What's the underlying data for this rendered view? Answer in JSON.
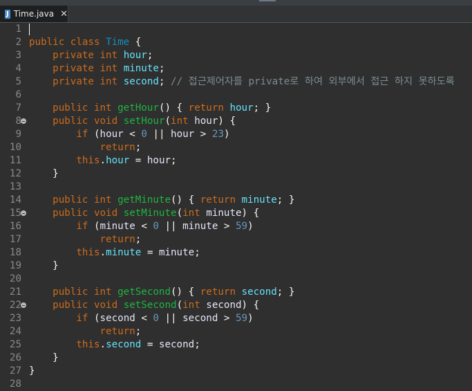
{
  "editor_tab": {
    "file_icon": "java-file-icon",
    "icon_letter": "J",
    "title": "Time.java",
    "close_glyph": "✕"
  },
  "colors": {
    "keyword": "#cc6c1d",
    "type_name": "#1290c3",
    "field": "#66e1f8",
    "method": "#1eb540",
    "number": "#6897bb",
    "comment": "#7d8c93",
    "background": "#2f2f2f"
  },
  "lines": [
    {
      "no": "1",
      "fold": false,
      "tokens": []
    },
    {
      "no": "2",
      "fold": false,
      "tokens": [
        [
          "kw",
          "public"
        ],
        [
          "pn",
          " "
        ],
        [
          "kw",
          "class"
        ],
        [
          "pn",
          " "
        ],
        [
          "ty",
          "Time"
        ],
        [
          "pn",
          " {"
        ]
      ]
    },
    {
      "no": "3",
      "fold": false,
      "tokens": [
        [
          "pn",
          "    "
        ],
        [
          "kw",
          "private"
        ],
        [
          "pn",
          " "
        ],
        [
          "kw",
          "int"
        ],
        [
          "pn",
          " "
        ],
        [
          "fd",
          "hour"
        ],
        [
          "pn",
          ";"
        ]
      ]
    },
    {
      "no": "4",
      "fold": false,
      "tokens": [
        [
          "pn",
          "    "
        ],
        [
          "kw",
          "private"
        ],
        [
          "pn",
          " "
        ],
        [
          "kw",
          "int"
        ],
        [
          "pn",
          " "
        ],
        [
          "fd",
          "minute"
        ],
        [
          "pn",
          ";"
        ]
      ]
    },
    {
      "no": "5",
      "fold": false,
      "tokens": [
        [
          "pn",
          "    "
        ],
        [
          "kw",
          "private"
        ],
        [
          "pn",
          " "
        ],
        [
          "kw",
          "int"
        ],
        [
          "pn",
          " "
        ],
        [
          "fd",
          "second"
        ],
        [
          "pn",
          "; "
        ],
        [
          "cm",
          "// 접근제어자를 private로 하여 외부에서 접근 하지 못하도록"
        ]
      ]
    },
    {
      "no": "6",
      "fold": false,
      "tokens": []
    },
    {
      "no": "7",
      "fold": false,
      "tokens": [
        [
          "pn",
          "    "
        ],
        [
          "kw",
          "public"
        ],
        [
          "pn",
          " "
        ],
        [
          "kw",
          "int"
        ],
        [
          "pn",
          " "
        ],
        [
          "fn",
          "getHour"
        ],
        [
          "pn",
          "() { "
        ],
        [
          "kw",
          "return"
        ],
        [
          "pn",
          " "
        ],
        [
          "fd",
          "hour"
        ],
        [
          "pn",
          "; }"
        ]
      ]
    },
    {
      "no": "8",
      "fold": true,
      "tokens": [
        [
          "pn",
          "    "
        ],
        [
          "kw",
          "public"
        ],
        [
          "pn",
          " "
        ],
        [
          "kw",
          "void"
        ],
        [
          "pn",
          " "
        ],
        [
          "fn",
          "setHour"
        ],
        [
          "pn",
          "("
        ],
        [
          "kw",
          "int"
        ],
        [
          "pn",
          " "
        ],
        [
          "op",
          "hour"
        ],
        [
          "pn",
          ") {"
        ]
      ]
    },
    {
      "no": "9",
      "fold": false,
      "tokens": [
        [
          "pn",
          "        "
        ],
        [
          "kw",
          "if"
        ],
        [
          "pn",
          " ("
        ],
        [
          "op",
          "hour"
        ],
        [
          "pn",
          " < "
        ],
        [
          "nm",
          "0"
        ],
        [
          "pn",
          " || "
        ],
        [
          "op",
          "hour"
        ],
        [
          "pn",
          " > "
        ],
        [
          "nm",
          "23"
        ],
        [
          "pn",
          ")"
        ]
      ]
    },
    {
      "no": "10",
      "fold": false,
      "tokens": [
        [
          "pn",
          "            "
        ],
        [
          "kw",
          "return"
        ],
        [
          "pn",
          ";"
        ]
      ]
    },
    {
      "no": "11",
      "fold": false,
      "tokens": [
        [
          "pn",
          "        "
        ],
        [
          "kw",
          "this"
        ],
        [
          "pn",
          "."
        ],
        [
          "fd",
          "hour"
        ],
        [
          "pn",
          " = "
        ],
        [
          "op",
          "hour"
        ],
        [
          "pn",
          ";"
        ]
      ]
    },
    {
      "no": "12",
      "fold": false,
      "tokens": [
        [
          "pn",
          "    }"
        ]
      ]
    },
    {
      "no": "13",
      "fold": false,
      "tokens": []
    },
    {
      "no": "14",
      "fold": false,
      "tokens": [
        [
          "pn",
          "    "
        ],
        [
          "kw",
          "public"
        ],
        [
          "pn",
          " "
        ],
        [
          "kw",
          "int"
        ],
        [
          "pn",
          " "
        ],
        [
          "fn",
          "getMinute"
        ],
        [
          "pn",
          "() { "
        ],
        [
          "kw",
          "return"
        ],
        [
          "pn",
          " "
        ],
        [
          "fd",
          "minute"
        ],
        [
          "pn",
          "; }"
        ]
      ]
    },
    {
      "no": "15",
      "fold": true,
      "tokens": [
        [
          "pn",
          "    "
        ],
        [
          "kw",
          "public"
        ],
        [
          "pn",
          " "
        ],
        [
          "kw",
          "void"
        ],
        [
          "pn",
          " "
        ],
        [
          "fn",
          "setMinute"
        ],
        [
          "pn",
          "("
        ],
        [
          "kw",
          "int"
        ],
        [
          "pn",
          " "
        ],
        [
          "op",
          "minute"
        ],
        [
          "pn",
          ") {"
        ]
      ]
    },
    {
      "no": "16",
      "fold": false,
      "tokens": [
        [
          "pn",
          "        "
        ],
        [
          "kw",
          "if"
        ],
        [
          "pn",
          " ("
        ],
        [
          "op",
          "minute"
        ],
        [
          "pn",
          " < "
        ],
        [
          "nm",
          "0"
        ],
        [
          "pn",
          " || "
        ],
        [
          "op",
          "minute"
        ],
        [
          "pn",
          " > "
        ],
        [
          "nm",
          "59"
        ],
        [
          "pn",
          ")"
        ]
      ]
    },
    {
      "no": "17",
      "fold": false,
      "tokens": [
        [
          "pn",
          "            "
        ],
        [
          "kw",
          "return"
        ],
        [
          "pn",
          ";"
        ]
      ]
    },
    {
      "no": "18",
      "fold": false,
      "tokens": [
        [
          "pn",
          "        "
        ],
        [
          "kw",
          "this"
        ],
        [
          "pn",
          "."
        ],
        [
          "fd",
          "minute"
        ],
        [
          "pn",
          " = "
        ],
        [
          "op",
          "minute"
        ],
        [
          "pn",
          ";"
        ]
      ]
    },
    {
      "no": "19",
      "fold": false,
      "tokens": [
        [
          "pn",
          "    }"
        ]
      ]
    },
    {
      "no": "20",
      "fold": false,
      "tokens": []
    },
    {
      "no": "21",
      "fold": false,
      "tokens": [
        [
          "pn",
          "    "
        ],
        [
          "kw",
          "public"
        ],
        [
          "pn",
          " "
        ],
        [
          "kw",
          "int"
        ],
        [
          "pn",
          " "
        ],
        [
          "fn",
          "getSecond"
        ],
        [
          "pn",
          "() { "
        ],
        [
          "kw",
          "return"
        ],
        [
          "pn",
          " "
        ],
        [
          "fd",
          "second"
        ],
        [
          "pn",
          "; }"
        ]
      ]
    },
    {
      "no": "22",
      "fold": true,
      "tokens": [
        [
          "pn",
          "    "
        ],
        [
          "kw",
          "public"
        ],
        [
          "pn",
          " "
        ],
        [
          "kw",
          "void"
        ],
        [
          "pn",
          " "
        ],
        [
          "fn",
          "setSecond"
        ],
        [
          "pn",
          "("
        ],
        [
          "kw",
          "int"
        ],
        [
          "pn",
          " "
        ],
        [
          "op",
          "second"
        ],
        [
          "pn",
          ") {"
        ]
      ]
    },
    {
      "no": "23",
      "fold": false,
      "tokens": [
        [
          "pn",
          "        "
        ],
        [
          "kw",
          "if"
        ],
        [
          "pn",
          " ("
        ],
        [
          "op",
          "second"
        ],
        [
          "pn",
          " < "
        ],
        [
          "nm",
          "0"
        ],
        [
          "pn",
          " || "
        ],
        [
          "op",
          "second"
        ],
        [
          "pn",
          " > "
        ],
        [
          "nm",
          "59"
        ],
        [
          "pn",
          ")"
        ]
      ]
    },
    {
      "no": "24",
      "fold": false,
      "tokens": [
        [
          "pn",
          "            "
        ],
        [
          "kw",
          "return"
        ],
        [
          "pn",
          ";"
        ]
      ]
    },
    {
      "no": "25",
      "fold": false,
      "tokens": [
        [
          "pn",
          "        "
        ],
        [
          "kw",
          "this"
        ],
        [
          "pn",
          "."
        ],
        [
          "fd",
          "second"
        ],
        [
          "pn",
          " = "
        ],
        [
          "op",
          "second"
        ],
        [
          "pn",
          ";"
        ]
      ]
    },
    {
      "no": "26",
      "fold": false,
      "tokens": [
        [
          "pn",
          "    }"
        ]
      ]
    },
    {
      "no": "27",
      "fold": false,
      "tokens": [
        [
          "pn",
          "}"
        ]
      ]
    },
    {
      "no": "28",
      "fold": false,
      "tokens": []
    }
  ]
}
